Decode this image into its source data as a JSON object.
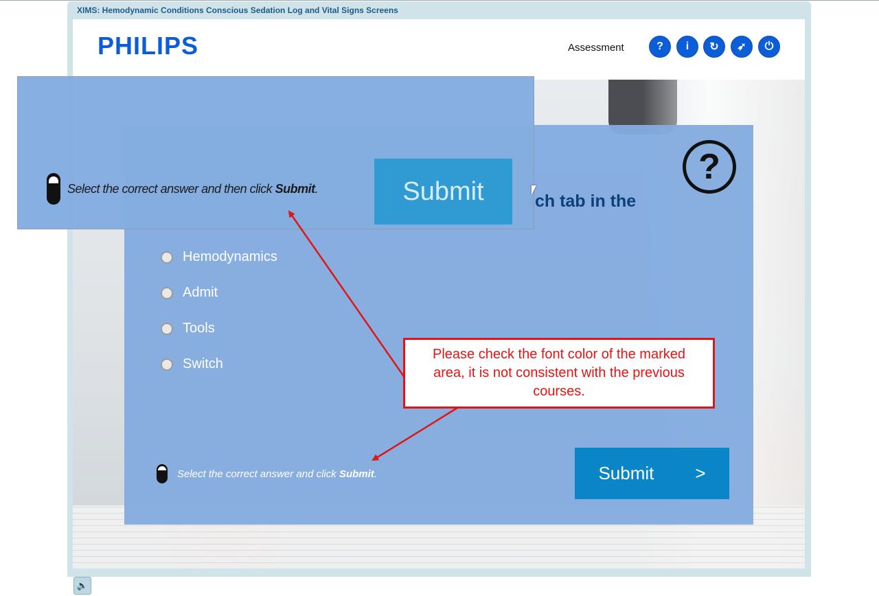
{
  "window": {
    "title": "XIMS: Hemodynamic Conditions Conscious Sedation Log and Vital Signs Screens"
  },
  "header": {
    "logo": "PHILIPS",
    "section": "Assessment",
    "buttons": [
      {
        "name": "help",
        "glyph": "?"
      },
      {
        "name": "info",
        "glyph": "i"
      },
      {
        "name": "replay",
        "glyph": "↻"
      },
      {
        "name": "navigate",
        "glyph": "➶"
      },
      {
        "name": "exit",
        "glyph": "⏻"
      }
    ]
  },
  "question": {
    "icon": "question-mark-icon",
    "text_visible": "ich tab in the",
    "options": [
      "Hemodynamics",
      "Admit",
      "Tools",
      "Switch"
    ]
  },
  "instruction": {
    "prefix": "Select the correct answer and click ",
    "bold": "Submit",
    "suffix": "."
  },
  "submit": {
    "label": "Submit",
    "arrow": ">"
  },
  "zoom_inset": {
    "instruction_prefix": "Select the correct answer and then click ",
    "instruction_bold": "Submit",
    "instruction_suffix": ".",
    "submit_label": "Submit"
  },
  "callout": {
    "text": "Please check the font color of the marked area, it is not consistent with the previous courses.",
    "color": "#e01515"
  },
  "colors": {
    "accent": "#0b5ed7",
    "submit_bg": "#0a86c8",
    "panel": "#84ace0"
  },
  "footer": {
    "audio_icon": "speaker-icon"
  }
}
